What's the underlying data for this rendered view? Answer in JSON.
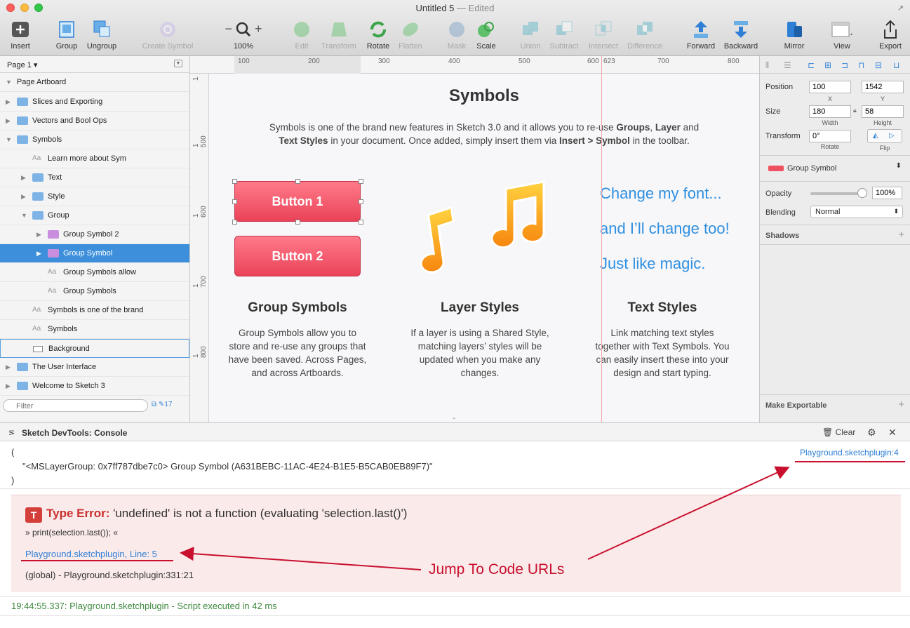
{
  "window": {
    "title": "Untitled 5",
    "status": "— Edited",
    "fullscreen_icon": "↗"
  },
  "toolbar": {
    "insert": "Insert",
    "group": "Group",
    "ungroup": "Ungroup",
    "create_symbol": "Create Symbol",
    "zoom": "100%",
    "zoom_minus": "−",
    "zoom_plus": "+",
    "edit": "Edit",
    "transform": "Transform",
    "rotate": "Rotate",
    "flatten": "Flatten",
    "mask": "Mask",
    "scale": "Scale",
    "union": "Union",
    "subtract": "Subtract",
    "intersect": "Intersect",
    "difference": "Difference",
    "forward": "Forward",
    "backward": "Backward",
    "mirror": "Mirror",
    "view": "View",
    "export": "Export"
  },
  "sidebar": {
    "page": "Page 1 ▾",
    "artboard": "Page Artboard",
    "layers": [
      "Slices and Exporting",
      "Vectors and Bool Ops",
      "Symbols",
      "Learn more about Sym",
      "Text",
      "Style",
      "Group",
      "Group Symbol 2",
      "Group Symbol",
      "Group Symbols allow",
      "Group Symbols",
      "Symbols is one of the brand",
      "Symbols",
      "Background",
      "The User Interface",
      "Welcome to Sketch 3"
    ],
    "aa": "Aa",
    "filter_placeholder": "Filter",
    "filter_count": "17"
  },
  "ruler": {
    "h": [
      "100",
      "200",
      "300",
      "400",
      "500",
      "600",
      "623",
      "700",
      "800"
    ],
    "v": [
      "1 500",
      "1 600",
      "1 700",
      "1 800"
    ],
    "v_top": "1"
  },
  "canvas": {
    "title": "Symbols",
    "intro_1a": "Symbols is one of the brand new features in Sketch 3.0 and it allows you to re-use ",
    "intro_1b": "Groups",
    "intro_1c": ", ",
    "intro_1d": "Layer",
    "intro_1e": " and",
    "intro_2a": "Text Styles",
    "intro_2b": " in your document. Once added, simply insert them via ",
    "intro_2c": "Insert > Symbol",
    "intro_2d": " in the toolbar.",
    "button1": "Button 1",
    "button2": "Button 2",
    "text_line1": "Change my font...",
    "text_line2": "and I’ll change too!",
    "text_line3": "Just like magic.",
    "col1_head": "Group Symbols",
    "col1_text": "Group Symbols allow you to store and re-use any groups that have been saved. Across Pages, and across Artboards.",
    "col2_head": "Layer Styles",
    "col2_text": "If a layer is using a Shared Style, matching layers’ styles will be updated when you make any changes.",
    "col3_head": "Text Styles",
    "col3_text": "Link matching text styles together with Text Symbols. You can easily insert these into your design and start typing."
  },
  "inspector": {
    "position_label": "Position",
    "x": "100",
    "y": "1542",
    "x_cap": "X",
    "y_cap": "Y",
    "size_label": "Size",
    "width": "180",
    "height": "58",
    "width_cap": "Width",
    "height_cap": "Height",
    "transform_label": "Transform",
    "rotate": "0°",
    "rotate_cap": "Rotate",
    "flip_cap": "Flip",
    "symbol_name": "Group Symbol",
    "opacity_label": "Opacity",
    "opacity": "100%",
    "blending_label": "Blending",
    "blending": "Normal",
    "shadows": "Shadows",
    "make_exportable": "Make Exportable"
  },
  "console": {
    "title": "Sketch DevTools: Console",
    "clear": "Clear",
    "open_paren": "(",
    "log_line": "\"<MSLayerGroup: 0x7ff787dbe7c0> Group Symbol (A631BEBC-11AC-4E24-B1E5-B5CAB0EB89F7)\"",
    "close_paren": ")",
    "log_link": "Playground.sketchplugin:4",
    "error_badge": "T",
    "error_type": "Type Error:",
    "error_message": " 'undefined' is not a function (evaluating 'selection.last()')",
    "error_code": "» print(selection.last()); «",
    "error_link": "Playground.sketchplugin, Line: 5",
    "error_stack": "(global) - Playground.sketchplugin:331:21",
    "success": "19:44:55.337: Playground.sketchplugin - Script executed in 42 ms",
    "annotation": "Jump To Code URLs"
  },
  "colors": {
    "accent": "#2f7fd6",
    "error": "#c9302c",
    "annotation": "#c8102e",
    "selection": "#3d8fdb"
  }
}
